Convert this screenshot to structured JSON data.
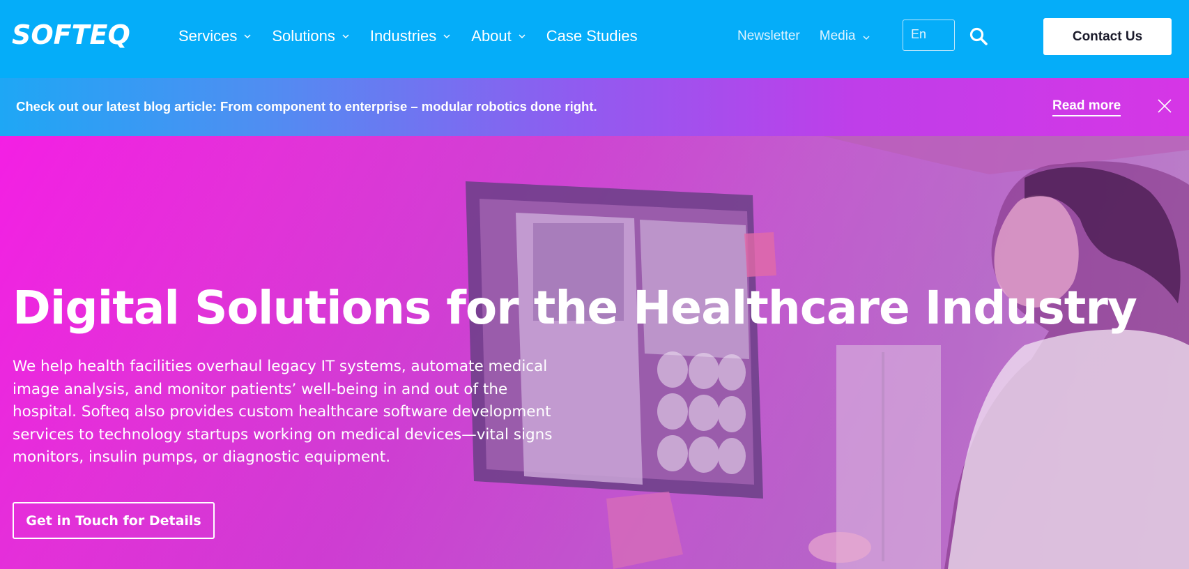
{
  "header": {
    "logo_text": "SOFTEQ",
    "nav": [
      {
        "label": "Services",
        "has_dropdown": true
      },
      {
        "label": "Solutions",
        "has_dropdown": true
      },
      {
        "label": "Industries",
        "has_dropdown": true
      },
      {
        "label": "About",
        "has_dropdown": true
      },
      {
        "label": "Case Studies",
        "has_dropdown": false
      }
    ],
    "secondary_nav": [
      {
        "label": "Newsletter",
        "has_dropdown": false
      },
      {
        "label": "Media",
        "has_dropdown": true
      }
    ],
    "language": "En",
    "search_icon": "search-icon",
    "contact_label": "Contact Us"
  },
  "banner": {
    "text": "Check out our latest blog article: From component to enterprise – modular robotics done right.",
    "link_label": "Read more",
    "close_icon": "close-icon"
  },
  "hero": {
    "title": "Digital Solutions for the Healthcare Industry",
    "description": "We help health facilities overhaul legacy IT systems, automate medical image analysis, and monitor patients’ well-being in and out of the hospital. Softeq also provides custom healthcare software development services to technology startups working on medical devices—vital signs monitors, insulin pumps, or diagnostic equipment.",
    "cta_label": "Get in Touch for Details"
  },
  "colors": {
    "header_bg": "#05adf9",
    "banner_gradient_start": "#1ea7f5",
    "banner_gradient_end": "#d636e6",
    "hero_overlay": "#e231d8"
  }
}
